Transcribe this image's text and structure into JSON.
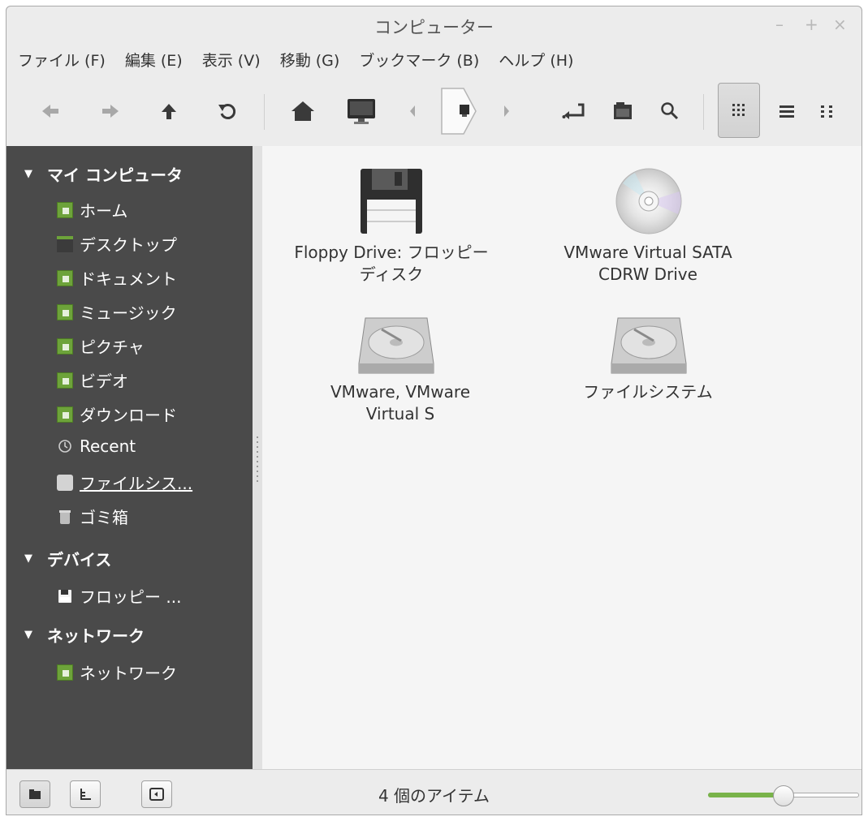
{
  "window": {
    "title": "コンピューター",
    "controls": {
      "minimize": "–",
      "maximize": "+",
      "close": "×"
    }
  },
  "menubar": [
    {
      "label": "ファイル (F)"
    },
    {
      "label": "編集 (E)"
    },
    {
      "label": "表示 (V)"
    },
    {
      "label": "移動 (G)"
    },
    {
      "label": "ブックマーク (B)"
    },
    {
      "label": "ヘルプ (H)"
    }
  ],
  "toolbar": {
    "buttons": [
      "back-icon",
      "forward-icon",
      "up-icon",
      "reload-icon",
      "home-icon",
      "computer-icon",
      "path-left-icon",
      "path-right-icon",
      "toggle-location-icon",
      "open-terminal-icon",
      "search-icon",
      "icon-view-icon",
      "list-view-icon",
      "compact-view-icon"
    ],
    "active_view": "icon-view"
  },
  "sidebar": {
    "sections": [
      {
        "label": "マイ コンピュータ",
        "expanded": true,
        "items": [
          {
            "label": "ホーム",
            "icon": "home-folder-icon"
          },
          {
            "label": "デスクトップ",
            "icon": "desktop-icon"
          },
          {
            "label": "ドキュメント",
            "icon": "documents-folder-icon"
          },
          {
            "label": "ミュージック",
            "icon": "music-folder-icon"
          },
          {
            "label": "ピクチャ",
            "icon": "pictures-folder-icon"
          },
          {
            "label": "ビデオ",
            "icon": "videos-folder-icon"
          },
          {
            "label": "ダウンロード",
            "icon": "downloads-folder-icon"
          },
          {
            "label": "Recent",
            "icon": "recent-icon"
          },
          {
            "label": "ファイルシス...",
            "icon": "drive-icon",
            "selected": true
          },
          {
            "label": "ゴミ箱",
            "icon": "trash-icon"
          }
        ]
      },
      {
        "label": "デバイス",
        "expanded": true,
        "items": [
          {
            "label": "フロッピー ...",
            "icon": "floppy-icon"
          }
        ]
      },
      {
        "label": "ネットワーク",
        "expanded": true,
        "items": [
          {
            "label": "ネットワーク",
            "icon": "network-folder-icon"
          }
        ]
      }
    ]
  },
  "main": {
    "items": [
      {
        "line1": "Floppy Drive: フロッピー",
        "line2": "ディスク",
        "icon": "floppy-drive-icon"
      },
      {
        "line1": "VMware Virtual SATA",
        "line2": "CDRW Drive",
        "icon": "optical-disc-icon"
      },
      {
        "line1": "VMware, VMware",
        "line2": "Virtual S",
        "icon": "hard-disk-icon"
      },
      {
        "line1": "ファイルシステム",
        "line2": "",
        "icon": "hard-disk-icon"
      }
    ]
  },
  "statusbar": {
    "text": "4 個のアイテム",
    "zoom_level": 0.5
  },
  "colors": {
    "sidebar_bg": "#4a4a4a",
    "accent": "#6da33a",
    "main_bg": "#f5f5f5"
  }
}
